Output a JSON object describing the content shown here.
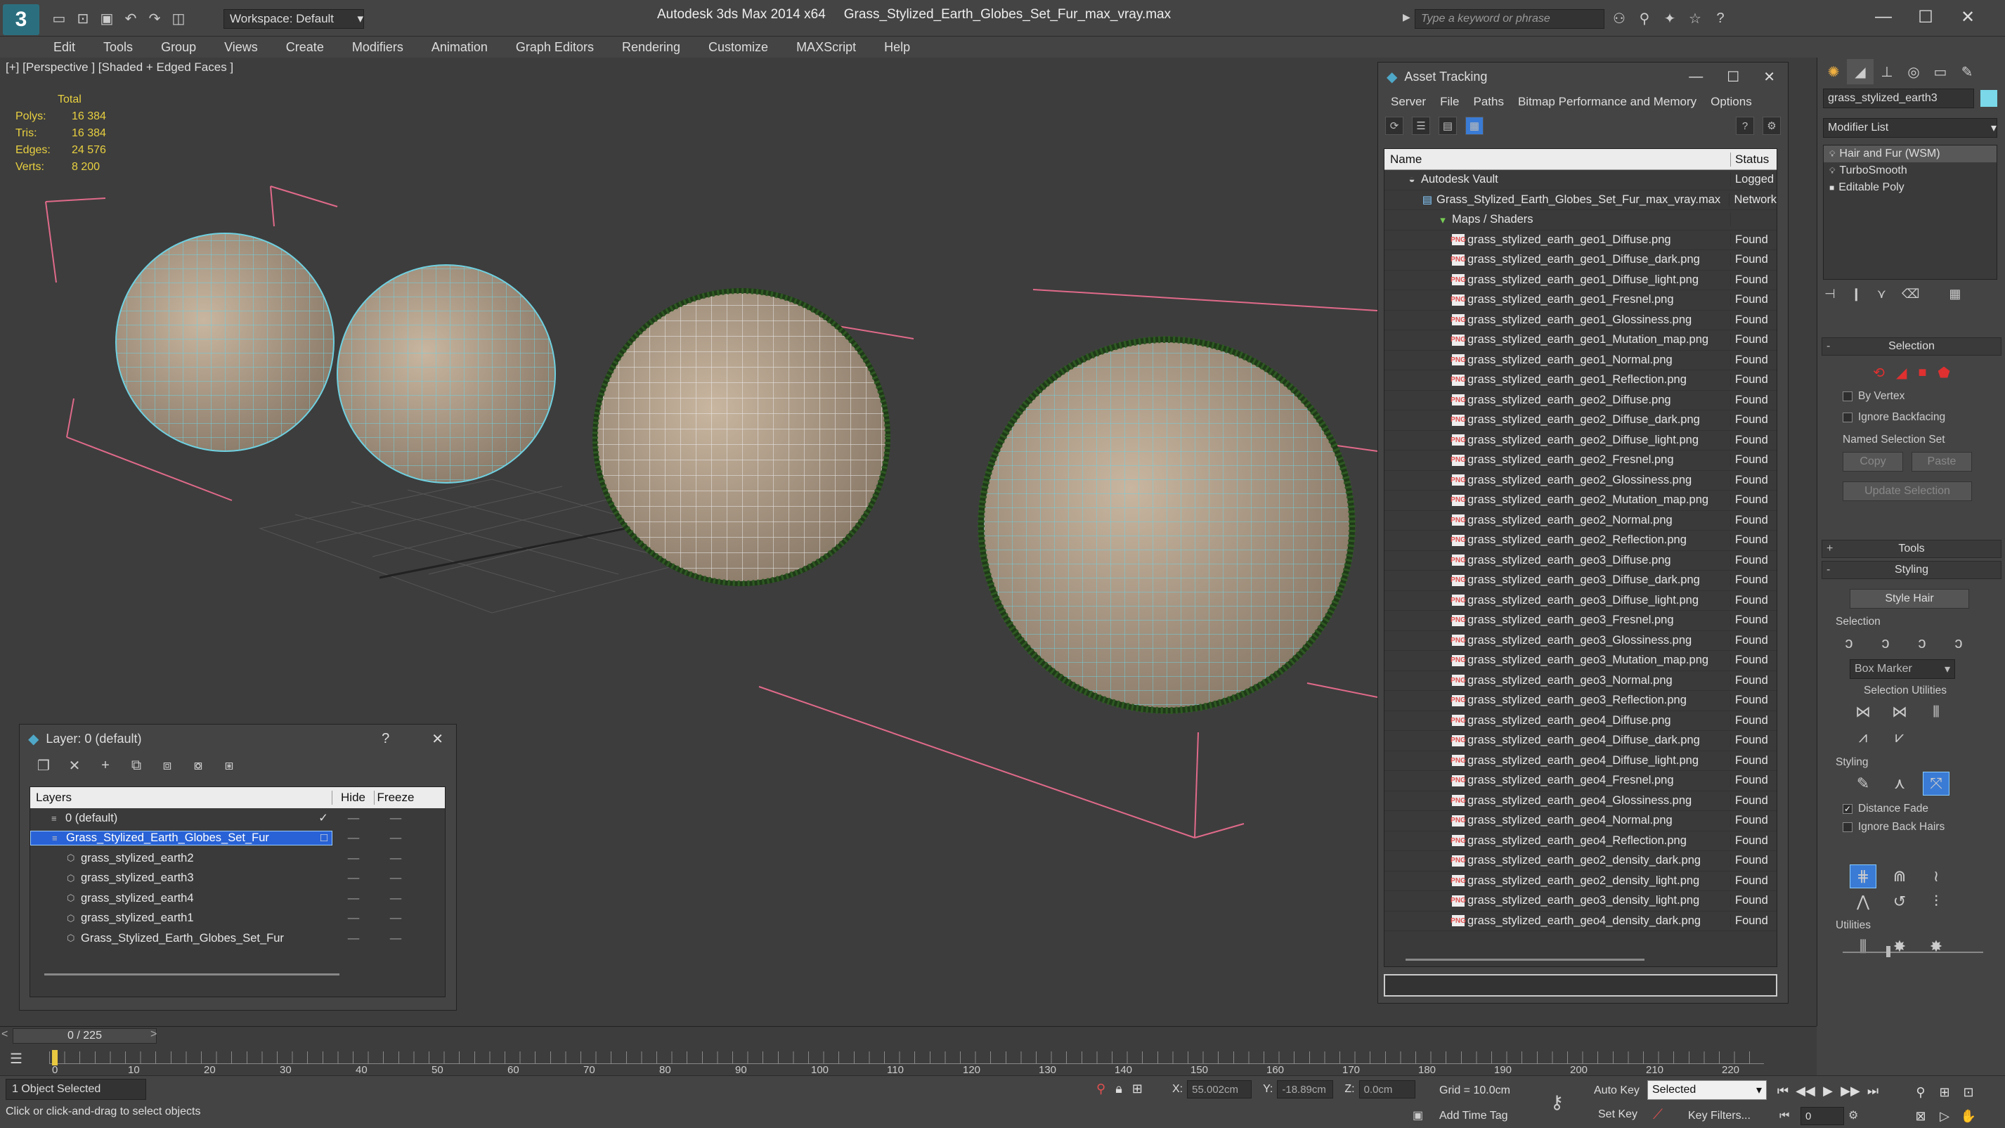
{
  "titlebar": {
    "workspace": "Workspace: Default",
    "app_name": "Autodesk 3ds Max  2014 x64",
    "file_name": "Grass_Stylized_Earth_Globes_Set_Fur_max_vray.max",
    "search_placeholder": "Type a keyword or phrase"
  },
  "menus": [
    "Edit",
    "Tools",
    "Group",
    "Views",
    "Create",
    "Modifiers",
    "Animation",
    "Graph Editors",
    "Rendering",
    "Customize",
    "MAXScript",
    "Help"
  ],
  "viewport": {
    "label": "[+] [Perspective ] [Shaded + Edged Faces ]",
    "stats_header": "Total",
    "stats": [
      {
        "k": "Polys:",
        "v": "16 384"
      },
      {
        "k": "Tris:",
        "v": "16 384"
      },
      {
        "k": "Edges:",
        "v": "24 576"
      },
      {
        "k": "Verts:",
        "v": "8 200"
      }
    ]
  },
  "asset_tracking": {
    "title": "Asset Tracking",
    "menu": [
      "Server",
      "File",
      "Paths",
      "Bitmap Performance and Memory",
      "Options"
    ],
    "col_name": "Name",
    "col_status": "Status",
    "rows": [
      {
        "name": "Autodesk Vault",
        "status": "Logged",
        "indent": 1,
        "icon": "vault"
      },
      {
        "name": "Grass_Stylized_Earth_Globes_Set_Fur_max_vray.max",
        "status": "Network",
        "indent": 2,
        "icon": "file"
      },
      {
        "name": "Maps / Shaders",
        "status": "",
        "indent": 3,
        "icon": "folder"
      },
      {
        "name": "grass_stylized_earth_geo1_Diffuse.png",
        "status": "Found",
        "indent": 4,
        "icon": "png"
      },
      {
        "name": "grass_stylized_earth_geo1_Diffuse_dark.png",
        "status": "Found",
        "indent": 4,
        "icon": "png"
      },
      {
        "name": "grass_stylized_earth_geo1_Diffuse_light.png",
        "status": "Found",
        "indent": 4,
        "icon": "png"
      },
      {
        "name": "grass_stylized_earth_geo1_Fresnel.png",
        "status": "Found",
        "indent": 4,
        "icon": "png"
      },
      {
        "name": "grass_stylized_earth_geo1_Glossiness.png",
        "status": "Found",
        "indent": 4,
        "icon": "png"
      },
      {
        "name": "grass_stylized_earth_geo1_Mutation_map.png",
        "status": "Found",
        "indent": 4,
        "icon": "png"
      },
      {
        "name": "grass_stylized_earth_geo1_Normal.png",
        "status": "Found",
        "indent": 4,
        "icon": "png"
      },
      {
        "name": "grass_stylized_earth_geo1_Reflection.png",
        "status": "Found",
        "indent": 4,
        "icon": "png"
      },
      {
        "name": "grass_stylized_earth_geo2_Diffuse.png",
        "status": "Found",
        "indent": 4,
        "icon": "png"
      },
      {
        "name": "grass_stylized_earth_geo2_Diffuse_dark.png",
        "status": "Found",
        "indent": 4,
        "icon": "png"
      },
      {
        "name": "grass_stylized_earth_geo2_Diffuse_light.png",
        "status": "Found",
        "indent": 4,
        "icon": "png"
      },
      {
        "name": "grass_stylized_earth_geo2_Fresnel.png",
        "status": "Found",
        "indent": 4,
        "icon": "png"
      },
      {
        "name": "grass_stylized_earth_geo2_Glossiness.png",
        "status": "Found",
        "indent": 4,
        "icon": "png"
      },
      {
        "name": "grass_stylized_earth_geo2_Mutation_map.png",
        "status": "Found",
        "indent": 4,
        "icon": "png"
      },
      {
        "name": "grass_stylized_earth_geo2_Normal.png",
        "status": "Found",
        "indent": 4,
        "icon": "png"
      },
      {
        "name": "grass_stylized_earth_geo2_Reflection.png",
        "status": "Found",
        "indent": 4,
        "icon": "png"
      },
      {
        "name": "grass_stylized_earth_geo3_Diffuse.png",
        "status": "Found",
        "indent": 4,
        "icon": "png"
      },
      {
        "name": "grass_stylized_earth_geo3_Diffuse_dark.png",
        "status": "Found",
        "indent": 4,
        "icon": "png"
      },
      {
        "name": "grass_stylized_earth_geo3_Diffuse_light.png",
        "status": "Found",
        "indent": 4,
        "icon": "png"
      },
      {
        "name": "grass_stylized_earth_geo3_Fresnel.png",
        "status": "Found",
        "indent": 4,
        "icon": "png"
      },
      {
        "name": "grass_stylized_earth_geo3_Glossiness.png",
        "status": "Found",
        "indent": 4,
        "icon": "png"
      },
      {
        "name": "grass_stylized_earth_geo3_Mutation_map.png",
        "status": "Found",
        "indent": 4,
        "icon": "png"
      },
      {
        "name": "grass_stylized_earth_geo3_Normal.png",
        "status": "Found",
        "indent": 4,
        "icon": "png"
      },
      {
        "name": "grass_stylized_earth_geo3_Reflection.png",
        "status": "Found",
        "indent": 4,
        "icon": "png"
      },
      {
        "name": "grass_stylized_earth_geo4_Diffuse.png",
        "status": "Found",
        "indent": 4,
        "icon": "png"
      },
      {
        "name": "grass_stylized_earth_geo4_Diffuse_dark.png",
        "status": "Found",
        "indent": 4,
        "icon": "png"
      },
      {
        "name": "grass_stylized_earth_geo4_Diffuse_light.png",
        "status": "Found",
        "indent": 4,
        "icon": "png"
      },
      {
        "name": "grass_stylized_earth_geo4_Fresnel.png",
        "status": "Found",
        "indent": 4,
        "icon": "png"
      },
      {
        "name": "grass_stylized_earth_geo4_Glossiness.png",
        "status": "Found",
        "indent": 4,
        "icon": "png"
      },
      {
        "name": "grass_stylized_earth_geo4_Normal.png",
        "status": "Found",
        "indent": 4,
        "icon": "png"
      },
      {
        "name": "grass_stylized_earth_geo4_Reflection.png",
        "status": "Found",
        "indent": 4,
        "icon": "png"
      },
      {
        "name": "grass_stylized_earth_geo2_density_dark.png",
        "status": "Found",
        "indent": 4,
        "icon": "png"
      },
      {
        "name": "grass_stylized_earth_geo2_density_light.png",
        "status": "Found",
        "indent": 4,
        "icon": "png"
      },
      {
        "name": "grass_stylized_earth_geo3_density_light.png",
        "status": "Found",
        "indent": 4,
        "icon": "png"
      },
      {
        "name": "grass_stylized_earth_geo4_density_dark.png",
        "status": "Found",
        "indent": 4,
        "icon": "png"
      }
    ]
  },
  "layer_window": {
    "title": "Layer: 0 (default)",
    "col_layers": "Layers",
    "col_hide": "Hide",
    "col_freeze": "Freeze",
    "rows": [
      {
        "name": "0 (default)",
        "indent": 1,
        "selected": false,
        "check": "✓"
      },
      {
        "name": "Grass_Stylized_Earth_Globes_Set_Fur",
        "indent": 1,
        "selected": true,
        "check": "□"
      },
      {
        "name": "grass_stylized_earth2",
        "indent": 2,
        "selected": false,
        "check": ""
      },
      {
        "name": "grass_stylized_earth3",
        "indent": 2,
        "selected": false,
        "check": ""
      },
      {
        "name": "grass_stylized_earth4",
        "indent": 2,
        "selected": false,
        "check": ""
      },
      {
        "name": "grass_stylized_earth1",
        "indent": 2,
        "selected": false,
        "check": ""
      },
      {
        "name": "Grass_Stylized_Earth_Globes_Set_Fur",
        "indent": 2,
        "selected": false,
        "check": ""
      }
    ]
  },
  "command_panel": {
    "object_name": "grass_stylized_earth3",
    "object_color": "#7ad8e8",
    "modifier_list": "Modifier List",
    "stack": [
      "Hair and Fur (WSM)",
      "TurboSmooth",
      "Editable Poly"
    ],
    "selection_rollout": "Selection",
    "by_vertex": "By Vertex",
    "ignore_backfacing": "Ignore Backfacing",
    "named_sel_set": "Named Selection Set",
    "copy": "Copy",
    "paste": "Paste",
    "update_selection": "Update Selection",
    "tools_rollout": "Tools",
    "styling_rollout": "Styling",
    "style_hair": "Style Hair",
    "selection_group": "Selection",
    "box_marker": "Box Marker",
    "selection_utilities": "Selection Utilities",
    "styling_group": "Styling",
    "distance_fade": "Distance Fade",
    "ignore_back_hairs": "Ignore Back Hairs",
    "utilities_group": "Utilities"
  },
  "timeline": {
    "frame_display": "0 / 225",
    "ticks": [
      "0",
      "10",
      "20",
      "30",
      "40",
      "50",
      "60",
      "70",
      "80",
      "90",
      "100",
      "110",
      "120",
      "130",
      "140",
      "150",
      "160",
      "170",
      "180",
      "190",
      "200",
      "210",
      "220"
    ]
  },
  "statusbar": {
    "selection_status": "1 Object Selected",
    "prompt": "Click or click-and-drag to select objects",
    "x_label": "X:",
    "x_value": "55.002cm",
    "y_label": "Y:",
    "y_value": "-18.89cm",
    "z_label": "Z:",
    "z_value": "0.0cm",
    "grid": "Grid = 10.0cm",
    "auto_key": "Auto Key",
    "set_key": "Set Key",
    "selected": "Selected",
    "key_filters": "Key Filters...",
    "add_time_tag": "Add Time Tag",
    "frame": "0"
  }
}
